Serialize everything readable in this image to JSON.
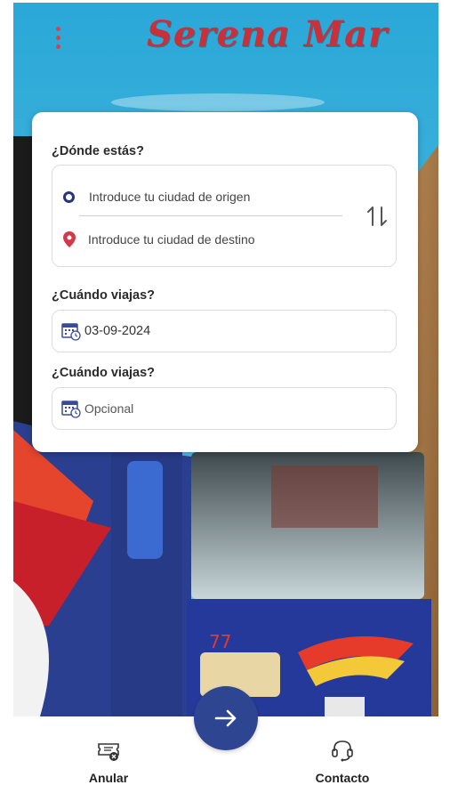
{
  "app": {
    "logo_text": "Serena Mar",
    "menu_icon": "more-vertical-icon"
  },
  "search_card": {
    "where_label": "¿Dónde estás?",
    "origin_placeholder": "Introduce tu ciudad de origen",
    "destination_placeholder": "Introduce tu ciudad de destino",
    "when_label": "¿Cuándo viajas?",
    "departure_date": "03-09-2024",
    "return_label": "¿Cuándo viajas?",
    "return_placeholder": "Opcional"
  },
  "bottom_nav": {
    "cancel_label": "Anular",
    "contact_label": "Contacto",
    "next_icon": "arrow-right-icon"
  },
  "colors": {
    "brand_red": "#c9303a",
    "brand_blue": "#2e4592",
    "origin_ring": "#27337a",
    "destination_pin": "#d23a4a"
  }
}
